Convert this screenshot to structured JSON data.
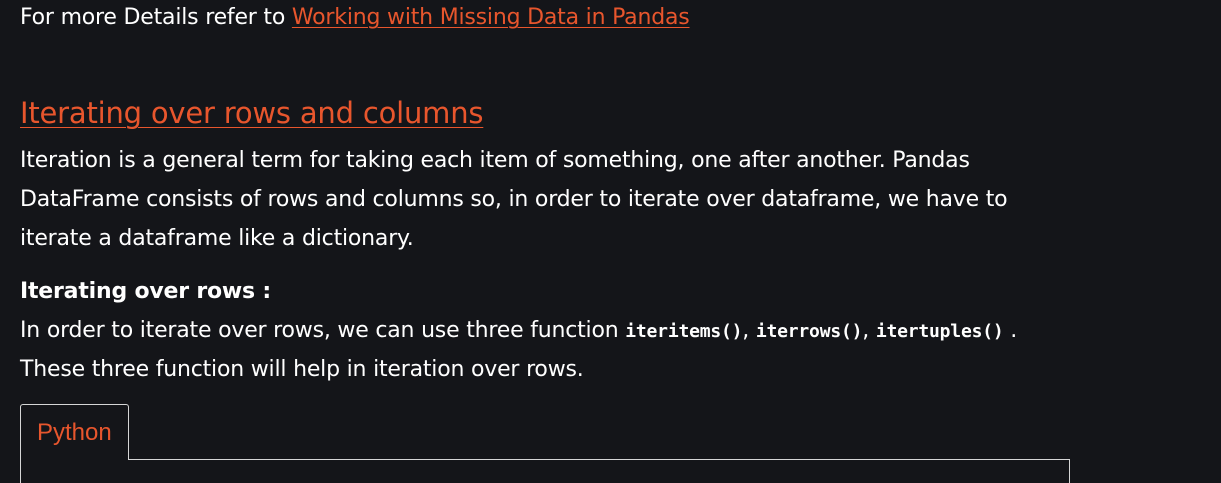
{
  "details_line": {
    "prefix": "For more Details refer to ",
    "link_text": "Working with Missing Data in Pandas"
  },
  "section": {
    "heading": "Iterating over rows and columns",
    "paragraph_lines": [
      "Iteration is a general term for taking each item of something, one after another. Pandas",
      "DataFrame consists of rows and columns so, in order to iterate over dataframe, we have to",
      "iterate a dataframe like a dictionary."
    ]
  },
  "rows_section": {
    "subheading": "Iterating over rows :",
    "line1_prefix": "In order to iterate over rows, we can use three function ",
    "functions": [
      "iteritems()",
      "iterrows()",
      "itertuples()"
    ],
    "separator": ", ",
    "line1_suffix": " .",
    "line2": "These three function will help in iteration over rows."
  },
  "code_tabs": {
    "active_label": "Python"
  }
}
